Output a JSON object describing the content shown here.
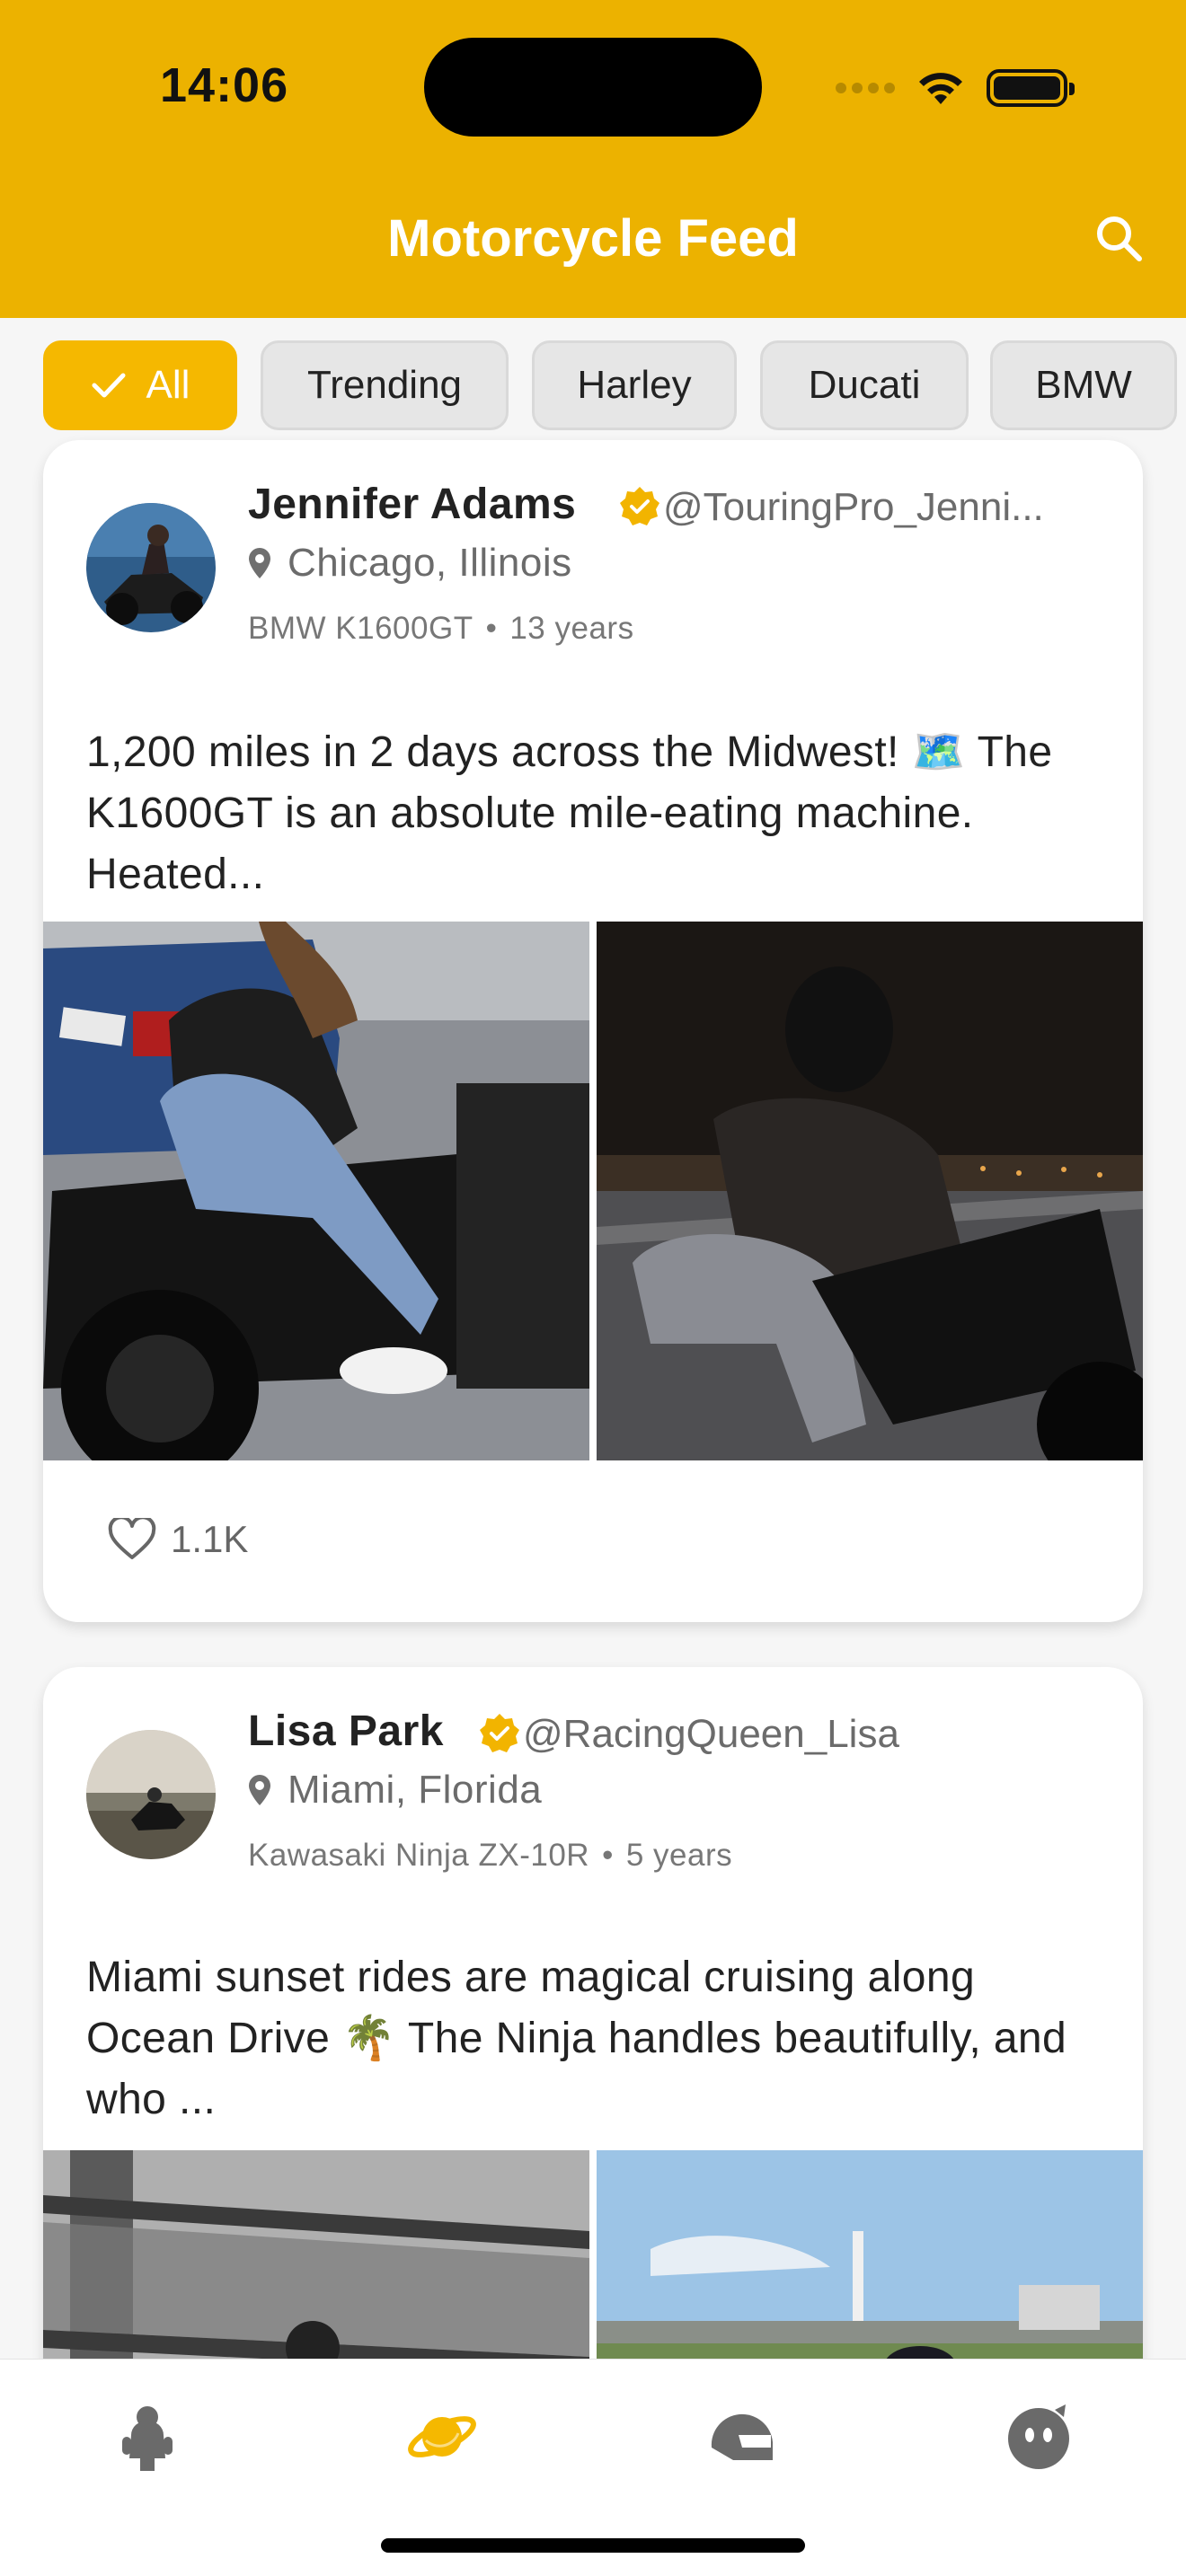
{
  "status_bar": {
    "time": "14:06"
  },
  "header": {
    "title": "Motorcycle Feed"
  },
  "filters": [
    {
      "label": "All",
      "active": true
    },
    {
      "label": "Trending",
      "active": false
    },
    {
      "label": "Harley",
      "active": false
    },
    {
      "label": "Ducati",
      "active": false
    },
    {
      "label": "BMW",
      "active": false
    }
  ],
  "posts": [
    {
      "name": "Jennifer Adams",
      "handle": "@TouringPro_Jenni...",
      "location": "Chicago, Illinois",
      "bike": "BMW K1600GT",
      "experience": "13 years",
      "text": "1,200 miles in 2 days across the Midwest! 🗺️ The K1600GT is an absolute mile-eating machine. Heated...",
      "likes": "1.1K"
    },
    {
      "name": "Lisa Park",
      "handle": "@RacingQueen_Lisa",
      "location": "Miami, Florida",
      "bike": "Kawasaki Ninja ZX-10R",
      "experience": "5 years",
      "text": "Miami sunset rides are magical cruising along Ocean Drive 🌴  The Ninja handles beautifully, and who ...",
      "likes": ""
    }
  ],
  "separator": "•",
  "colors": {
    "accent": "#ecb200",
    "verified": "#f2b400",
    "chip_active": "#f5b800"
  },
  "bottom_nav": [
    {
      "icon": "rider-icon",
      "active": false
    },
    {
      "icon": "planet-icon",
      "active": true
    },
    {
      "icon": "helmet-icon",
      "active": false
    },
    {
      "icon": "profile-face-icon",
      "active": false
    }
  ]
}
